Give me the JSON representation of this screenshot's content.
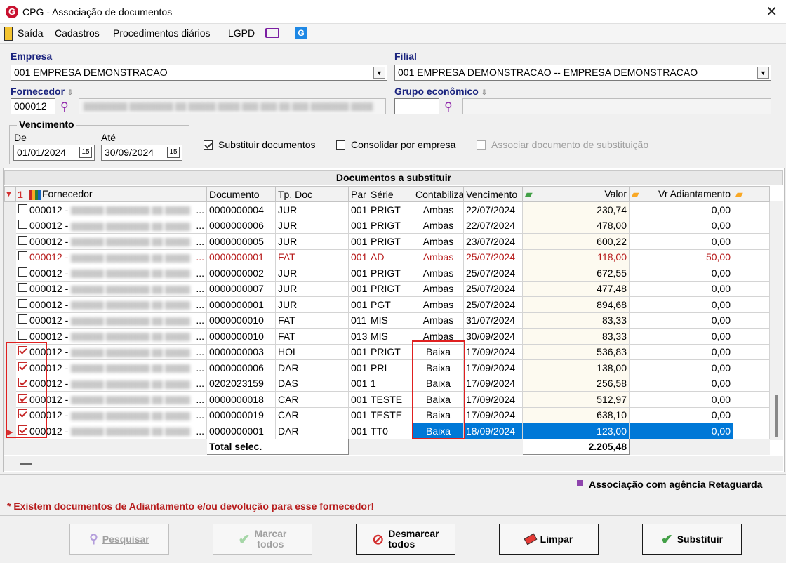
{
  "window": {
    "title": "CPG - Associação de documentos"
  },
  "menu": {
    "items": [
      "Saída",
      "Cadastros",
      "Procedimentos diários",
      "LGPD"
    ]
  },
  "empresa": {
    "label": "Empresa",
    "value": "001 EMPRESA DEMONSTRACAO"
  },
  "filial": {
    "label": "Filial",
    "value": "001 EMPRESA DEMONSTRACAO -- EMPRESA DEMONSTRACAO"
  },
  "fornecedor": {
    "label": "Fornecedor",
    "code": "000012"
  },
  "grupo": {
    "label": "Grupo econômico",
    "code": ""
  },
  "vencimento": {
    "label": "Vencimento",
    "de_label": "De",
    "ate_label": "Até",
    "de": "01/01/2024",
    "ate": "30/09/2024",
    "cal_glyph": "15"
  },
  "options": {
    "substituir": "Substituir documentos",
    "consolidar": "Consolidar por empresa",
    "associar": "Associar documento de substituição"
  },
  "grid": {
    "title": "Documentos a substituir",
    "columns": [
      "Fornecedor",
      "Documento",
      "Tp. Doc",
      "Par",
      "Série",
      "Contabiliza",
      "Vencimento",
      "Valor",
      "Vr Adiantamento"
    ],
    "sort_indicator": "1",
    "rows": [
      {
        "checked": false,
        "fornecedor": "000012 -",
        "doc": "0000000004",
        "tp": "JUR",
        "par": "001",
        "serie": "PRIGT",
        "contab": "Ambas",
        "venc": "22/07/2024",
        "valor": "230,74",
        "adiant": "0,00"
      },
      {
        "checked": false,
        "fornecedor": "000012 -",
        "doc": "0000000006",
        "tp": "JUR",
        "par": "001",
        "serie": "PRIGT",
        "contab": "Ambas",
        "venc": "22/07/2024",
        "valor": "478,00",
        "adiant": "0,00"
      },
      {
        "checked": false,
        "fornecedor": "000012 -",
        "doc": "0000000005",
        "tp": "JUR",
        "par": "001",
        "serie": "PRIGT",
        "contab": "Ambas",
        "venc": "23/07/2024",
        "valor": "600,22",
        "adiant": "0,00"
      },
      {
        "checked": false,
        "fornecedor": "000012 -",
        "doc": "0000000001",
        "tp": "FAT",
        "par": "001",
        "serie": "AD",
        "contab": "Ambas",
        "venc": "25/07/2024",
        "valor": "118,00",
        "adiant": "50,00",
        "red": true
      },
      {
        "checked": false,
        "fornecedor": "000012 -",
        "doc": "0000000002",
        "tp": "JUR",
        "par": "001",
        "serie": "PRIGT",
        "contab": "Ambas",
        "venc": "25/07/2024",
        "valor": "672,55",
        "adiant": "0,00"
      },
      {
        "checked": false,
        "fornecedor": "000012 -",
        "doc": "0000000007",
        "tp": "JUR",
        "par": "001",
        "serie": "PRIGT",
        "contab": "Ambas",
        "venc": "25/07/2024",
        "valor": "477,48",
        "adiant": "0,00"
      },
      {
        "checked": false,
        "fornecedor": "000012 -",
        "doc": "0000000001",
        "tp": "JUR",
        "par": "001",
        "serie": "PGT",
        "contab": "Ambas",
        "venc": "25/07/2024",
        "valor": "894,68",
        "adiant": "0,00"
      },
      {
        "checked": false,
        "fornecedor": "000012 -",
        "doc": "0000000010",
        "tp": "FAT",
        "par": "011",
        "serie": "MIS",
        "contab": "Ambas",
        "venc": "31/07/2024",
        "valor": "83,33",
        "adiant": "0,00"
      },
      {
        "checked": false,
        "fornecedor": "000012 -",
        "doc": "0000000010",
        "tp": "FAT",
        "par": "013",
        "serie": "MIS",
        "contab": "Ambas",
        "venc": "30/09/2024",
        "valor": "83,33",
        "adiant": "0,00"
      },
      {
        "checked": true,
        "fornecedor": "000012 -",
        "doc": "0000000003",
        "tp": "HOL",
        "par": "001",
        "serie": "PRIGT",
        "contab": "Baixa",
        "venc": "17/09/2024",
        "valor": "536,83",
        "adiant": "0,00"
      },
      {
        "checked": true,
        "fornecedor": "000012 -",
        "doc": "0000000006",
        "tp": "DAR",
        "par": "001",
        "serie": "PRI",
        "contab": "Baixa",
        "venc": "17/09/2024",
        "valor": "138,00",
        "adiant": "0,00"
      },
      {
        "checked": true,
        "fornecedor": "000012 -",
        "doc": "0202023159",
        "tp": "DAS",
        "par": "001",
        "serie": "1",
        "contab": "Baixa",
        "venc": "17/09/2024",
        "valor": "256,58",
        "adiant": "0,00"
      },
      {
        "checked": true,
        "fornecedor": "000012 -",
        "doc": "0000000018",
        "tp": "CAR",
        "par": "001",
        "serie": "TESTE",
        "contab": "Baixa",
        "venc": "17/09/2024",
        "valor": "512,97",
        "adiant": "0,00"
      },
      {
        "checked": true,
        "fornecedor": "000012 -",
        "doc": "0000000019",
        "tp": "CAR",
        "par": "001",
        "serie": "TESTE",
        "contab": "Baixa",
        "venc": "17/09/2024",
        "valor": "638,10",
        "adiant": "0,00"
      },
      {
        "checked": true,
        "fornecedor": "000012 -",
        "doc": "0000000001",
        "tp": "DAR",
        "par": "001",
        "serie": "TT0",
        "contab": "Baixa",
        "venc": "18/09/2024",
        "valor": "123,00",
        "adiant": "0,00",
        "selected": true
      }
    ],
    "total_label": "Total selec.",
    "total_value": "2.205,48"
  },
  "legend": {
    "text": "Associação com agência Retaguarda",
    "color": "#8e44ad"
  },
  "warning": "* Existem documentos de Adiantamento e/ou devolução para esse fornecedor!",
  "buttons": {
    "pesquisar": "Pesquisar",
    "marcar_1": "Marcar",
    "marcar_2": "todos",
    "desmarcar_1": "Desmarcar",
    "desmarcar_2": "todos",
    "limpar": "Limpar",
    "substituir": "Substituir"
  },
  "colors": {
    "accent_blue": "#1a237e",
    "selection": "#0078d7",
    "warning_red": "#b71c1c",
    "highlight_box": "#e02020"
  }
}
